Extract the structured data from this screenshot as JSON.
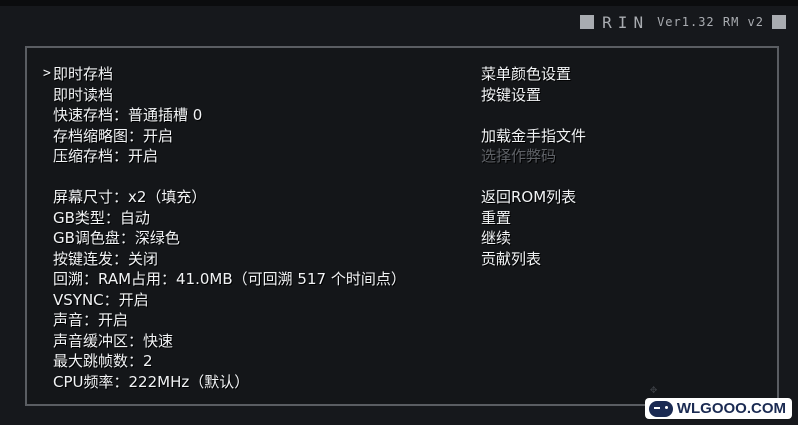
{
  "header": {
    "title": "RIN",
    "version": "Ver1.32 RM v2"
  },
  "menu_left": [
    {
      "label": "即时存档",
      "selected": true
    },
    {
      "label": "即时读档"
    },
    {
      "label": "快速存档：普通插槽 0"
    },
    {
      "label": "存档缩略图：开启"
    },
    {
      "label": "压缩存档：开启"
    },
    {
      "gap": true
    },
    {
      "label": "屏幕尺寸：x2（填充）"
    },
    {
      "label": "GB类型：自动"
    },
    {
      "label": "GB调色盘：深绿色"
    },
    {
      "label": "按键连发：关闭"
    },
    {
      "label": "回溯：RAM占用：41.0MB（可回溯 517 个时间点）"
    },
    {
      "label": "VSYNC：开启"
    },
    {
      "label": "声音：开启"
    },
    {
      "label": "声音缓冲区：快速"
    },
    {
      "label": "最大跳帧数：2"
    },
    {
      "label": "CPU频率：222MHz（默认）"
    }
  ],
  "menu_right": [
    {
      "label": "菜单颜色设置"
    },
    {
      "label": "按键设置"
    },
    {
      "gap": true
    },
    {
      "label": "加载金手指文件"
    },
    {
      "label": "选择作弊码",
      "disabled": true
    },
    {
      "gap": true
    },
    {
      "label": "返回ROM列表"
    },
    {
      "label": "重置"
    },
    {
      "label": "继续"
    },
    {
      "label": "贡献列表"
    }
  ],
  "cursor_glyph": ">",
  "watermark": {
    "text": "WLGOOO.COM",
    "icon": "gamepad-icon"
  },
  "colors": {
    "background": "#16181c",
    "panel_border": "#5a5d62",
    "text": "#f2f4f6",
    "disabled_text": "#5f6267",
    "header_text": "#a9acb1"
  }
}
